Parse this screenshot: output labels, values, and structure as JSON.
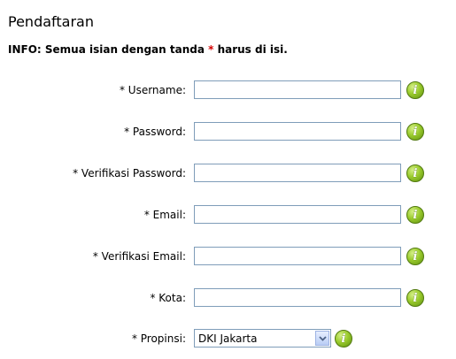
{
  "page": {
    "title": "Pendaftaran",
    "info_prefix": "INFO: Semua isian dengan tanda ",
    "info_star": "*",
    "info_suffix": " harus di isi."
  },
  "form": {
    "fields": [
      {
        "label": "* Username:",
        "value": ""
      },
      {
        "label": "* Password:",
        "value": ""
      },
      {
        "label": "* Verifikasi Password:",
        "value": ""
      },
      {
        "label": "* Email:",
        "value": ""
      },
      {
        "label": "* Verifikasi Email:",
        "value": ""
      },
      {
        "label": "* Kota:",
        "value": ""
      }
    ],
    "province": {
      "label": "* Propinsi:",
      "selected": "DKI Jakarta"
    }
  },
  "icons": {
    "help": "info-icon",
    "help_glyph": "i"
  }
}
